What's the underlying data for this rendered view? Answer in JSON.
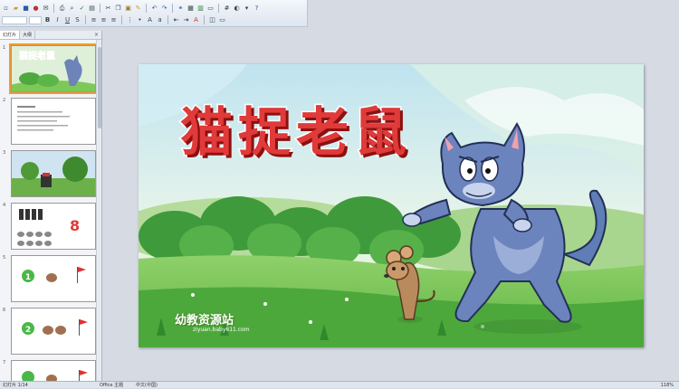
{
  "left_pane": {
    "tabs": [
      "幻灯片",
      "大纲"
    ],
    "close_glyph": "×",
    "thumbnails": [
      {
        "num": "1",
        "title": "猫捉老鼠"
      },
      {
        "num": "2"
      },
      {
        "num": "3"
      },
      {
        "num": "4",
        "count": "8"
      },
      {
        "num": "5",
        "count": "1"
      },
      {
        "num": "6",
        "count": "2"
      },
      {
        "num": "7"
      }
    ]
  },
  "slide": {
    "title": "猫捉老鼠",
    "watermark": "幼教资源站",
    "watermark_url": "ziyuan.baby611.com"
  },
  "statusbar": {
    "left": "幻灯片 1/14",
    "mid": "Office 主题",
    "center": "中文(中国)",
    "right": "118%"
  }
}
